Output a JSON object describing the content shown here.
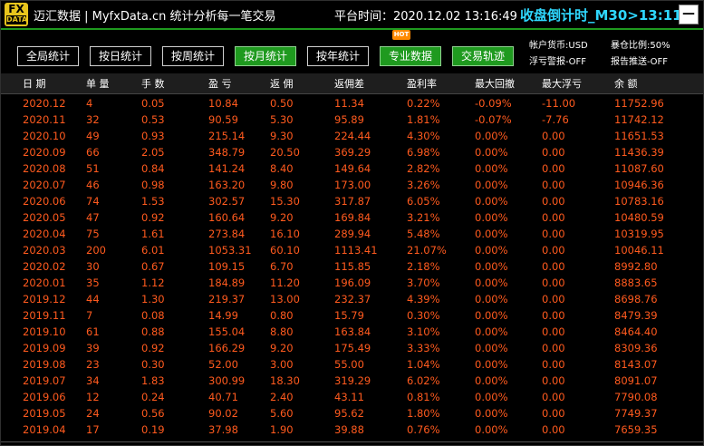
{
  "titlebar": {
    "logo_top": "FX",
    "logo_bottom": "DATA",
    "app_title": "迈汇数据 | MyfxData.cn  统计分析每一笔交易",
    "platform_time": "平台时间：2020.12.02 13:16:49",
    "countdown": "收盘倒计时_M30>13:11",
    "minimize": "—"
  },
  "toolbar": {
    "buttons": [
      {
        "label": "全局统计"
      },
      {
        "label": "按日统计"
      },
      {
        "label": "按周统计"
      },
      {
        "label": "按月统计"
      },
      {
        "label": "按年统计"
      },
      {
        "label": "专业数据"
      },
      {
        "label": "交易轨迹"
      }
    ],
    "hot_badge": "HOT",
    "info": {
      "currency": "帐户货币:USD",
      "exposure": "暴仓比例:50%",
      "float_alert": "浮亏警报-OFF",
      "report_push": "报告推送-OFF"
    }
  },
  "table": {
    "headers": [
      "日 期",
      "单 量",
      "手 数",
      "盈 亏",
      "返 佣",
      "返佣差",
      "盈利率",
      "最大回撤",
      "最大浮亏",
      "余 额"
    ],
    "rows": [
      [
        "2020.12",
        "4",
        "0.05",
        "10.84",
        "0.50",
        "11.34",
        "0.22%",
        "-0.09%",
        "-11.00",
        "11752.96"
      ],
      [
        "2020.11",
        "32",
        "0.53",
        "90.59",
        "5.30",
        "95.89",
        "1.81%",
        "-0.07%",
        "-7.76",
        "11742.12"
      ],
      [
        "2020.10",
        "49",
        "0.93",
        "215.14",
        "9.30",
        "224.44",
        "4.30%",
        "0.00%",
        "0.00",
        "11651.53"
      ],
      [
        "2020.09",
        "66",
        "2.05",
        "348.79",
        "20.50",
        "369.29",
        "6.98%",
        "0.00%",
        "0.00",
        "11436.39"
      ],
      [
        "2020.08",
        "51",
        "0.84",
        "141.24",
        "8.40",
        "149.64",
        "2.82%",
        "0.00%",
        "0.00",
        "11087.60"
      ],
      [
        "2020.07",
        "46",
        "0.98",
        "163.20",
        "9.80",
        "173.00",
        "3.26%",
        "0.00%",
        "0.00",
        "10946.36"
      ],
      [
        "2020.06",
        "74",
        "1.53",
        "302.57",
        "15.30",
        "317.87",
        "6.05%",
        "0.00%",
        "0.00",
        "10783.16"
      ],
      [
        "2020.05",
        "47",
        "0.92",
        "160.64",
        "9.20",
        "169.84",
        "3.21%",
        "0.00%",
        "0.00",
        "10480.59"
      ],
      [
        "2020.04",
        "75",
        "1.61",
        "273.84",
        "16.10",
        "289.94",
        "5.48%",
        "0.00%",
        "0.00",
        "10319.95"
      ],
      [
        "2020.03",
        "200",
        "6.01",
        "1053.31",
        "60.10",
        "1113.41",
        "21.07%",
        "0.00%",
        "0.00",
        "10046.11"
      ],
      [
        "2020.02",
        "30",
        "0.67",
        "109.15",
        "6.70",
        "115.85",
        "2.18%",
        "0.00%",
        "0.00",
        "8992.80"
      ],
      [
        "2020.01",
        "35",
        "1.12",
        "184.89",
        "11.20",
        "196.09",
        "3.70%",
        "0.00%",
        "0.00",
        "8883.65"
      ],
      [
        "2019.12",
        "44",
        "1.30",
        "219.37",
        "13.00",
        "232.37",
        "4.39%",
        "0.00%",
        "0.00",
        "8698.76"
      ],
      [
        "2019.11",
        "7",
        "0.08",
        "14.99",
        "0.80",
        "15.79",
        "0.30%",
        "0.00%",
        "0.00",
        "8479.39"
      ],
      [
        "2019.10",
        "61",
        "0.88",
        "155.04",
        "8.80",
        "163.84",
        "3.10%",
        "0.00%",
        "0.00",
        "8464.40"
      ],
      [
        "2019.09",
        "39",
        "0.92",
        "166.29",
        "9.20",
        "175.49",
        "3.33%",
        "0.00%",
        "0.00",
        "8309.36"
      ],
      [
        "2019.08",
        "23",
        "0.30",
        "52.00",
        "3.00",
        "55.00",
        "1.04%",
        "0.00%",
        "0.00",
        "8143.07"
      ],
      [
        "2019.07",
        "34",
        "1.83",
        "300.99",
        "18.30",
        "319.29",
        "6.02%",
        "0.00%",
        "0.00",
        "8091.07"
      ],
      [
        "2019.06",
        "12",
        "0.24",
        "40.71",
        "2.40",
        "43.11",
        "0.81%",
        "0.00%",
        "0.00",
        "7790.08"
      ],
      [
        "2019.05",
        "24",
        "0.56",
        "90.02",
        "5.60",
        "95.62",
        "1.80%",
        "0.00%",
        "0.00",
        "7749.37"
      ],
      [
        "2019.04",
        "17",
        "0.19",
        "37.98",
        "1.90",
        "39.88",
        "0.76%",
        "0.00%",
        "0.00",
        "7659.35"
      ]
    ]
  },
  "colors": {
    "accent_green": "#1f9a1f",
    "countdown_cyan": "#2fd8ff",
    "value_orange": "#ff5a1e"
  }
}
